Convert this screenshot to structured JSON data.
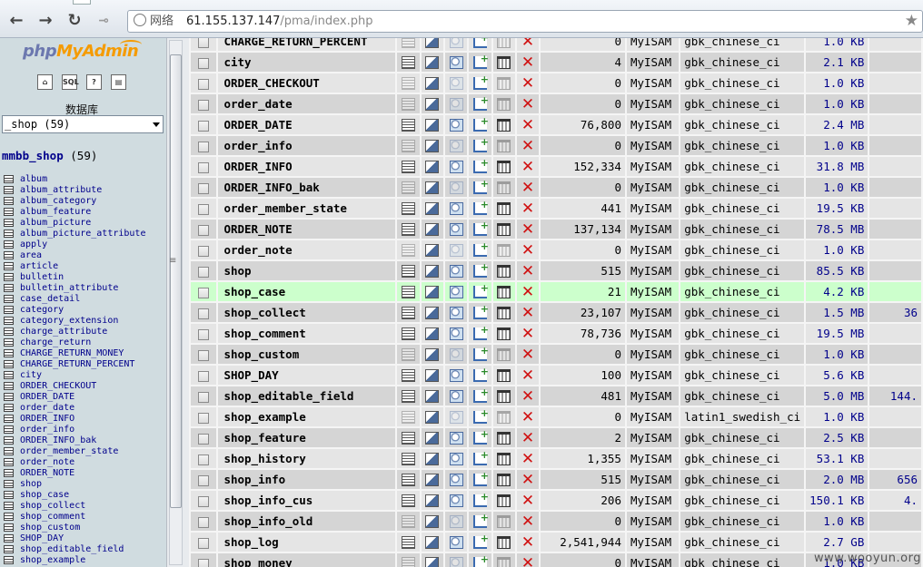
{
  "browser": {
    "site_label": "网络",
    "url_host": "61.155.137.147",
    "url_path": "/pma/index.php"
  },
  "sidebar": {
    "logo_php": "php",
    "logo_myadmin": "MyAdmin",
    "icons": [
      "home-icon",
      "sql-icon",
      "help-icon",
      "docs-icon"
    ],
    "icon_texts": [
      "⌂",
      "SQL",
      "?",
      "▤"
    ],
    "db_label": "数据库",
    "db_select": "_shop (59)",
    "db_name": "mmbb_shop",
    "db_count": "(59)",
    "tables": [
      "album",
      "album_attribute",
      "album_category",
      "album_feature",
      "album_picture",
      "album_picture_attribute",
      "apply",
      "area",
      "article",
      "bulletin",
      "bulletin_attribute",
      "case_detail",
      "category",
      "category_extension",
      "charge_attribute",
      "charge_return",
      "CHARGE_RETURN_MONEY",
      "CHARGE_RETURN_PERCENT",
      "city",
      "ORDER_CHECKOUT",
      "ORDER_DATE",
      "order_date",
      "ORDER_INFO",
      "order_info",
      "ORDER_INFO_bak",
      "order_member_state",
      "order_note",
      "ORDER_NOTE",
      "shop",
      "shop_case",
      "shop_collect",
      "shop_comment",
      "shop_custom",
      "SHOP_DAY",
      "shop_editable_field",
      "shop_example"
    ]
  },
  "main": {
    "rows": [
      {
        "name": "CHARGE_RETURN_PERCENT",
        "rows": "0",
        "type": "MyISAM",
        "collation": "gbk_chinese_ci",
        "size": "1.0 KB",
        "overhead": "",
        "empty": true,
        "marked": false
      },
      {
        "name": "city",
        "rows": "4",
        "type": "MyISAM",
        "collation": "gbk_chinese_ci",
        "size": "2.1 KB",
        "overhead": "",
        "empty": false,
        "marked": false
      },
      {
        "name": "ORDER_CHECKOUT",
        "rows": "0",
        "type": "MyISAM",
        "collation": "gbk_chinese_ci",
        "size": "1.0 KB",
        "overhead": "",
        "empty": true,
        "marked": false
      },
      {
        "name": "order_date",
        "rows": "0",
        "type": "MyISAM",
        "collation": "gbk_chinese_ci",
        "size": "1.0 KB",
        "overhead": "",
        "empty": true,
        "marked": false
      },
      {
        "name": "ORDER_DATE",
        "rows": "76,800",
        "type": "MyISAM",
        "collation": "gbk_chinese_ci",
        "size": "2.4 MB",
        "overhead": "",
        "empty": false,
        "marked": false
      },
      {
        "name": "order_info",
        "rows": "0",
        "type": "MyISAM",
        "collation": "gbk_chinese_ci",
        "size": "1.0 KB",
        "overhead": "",
        "empty": true,
        "marked": false
      },
      {
        "name": "ORDER_INFO",
        "rows": "152,334",
        "type": "MyISAM",
        "collation": "gbk_chinese_ci",
        "size": "31.8 MB",
        "overhead": "",
        "empty": false,
        "marked": false
      },
      {
        "name": "ORDER_INFO_bak",
        "rows": "0",
        "type": "MyISAM",
        "collation": "gbk_chinese_ci",
        "size": "1.0 KB",
        "overhead": "",
        "empty": true,
        "marked": false
      },
      {
        "name": "order_member_state",
        "rows": "441",
        "type": "MyISAM",
        "collation": "gbk_chinese_ci",
        "size": "19.5 KB",
        "overhead": "",
        "empty": false,
        "marked": false
      },
      {
        "name": "ORDER_NOTE",
        "rows": "137,134",
        "type": "MyISAM",
        "collation": "gbk_chinese_ci",
        "size": "78.5 MB",
        "overhead": "",
        "empty": false,
        "marked": false
      },
      {
        "name": "order_note",
        "rows": "0",
        "type": "MyISAM",
        "collation": "gbk_chinese_ci",
        "size": "1.0 KB",
        "overhead": "",
        "empty": true,
        "marked": false
      },
      {
        "name": "shop",
        "rows": "515",
        "type": "MyISAM",
        "collation": "gbk_chinese_ci",
        "size": "85.5 KB",
        "overhead": "",
        "empty": false,
        "marked": false
      },
      {
        "name": "shop_case",
        "rows": "21",
        "type": "MyISAM",
        "collation": "gbk_chinese_ci",
        "size": "4.2 KB",
        "overhead": "",
        "empty": false,
        "marked": true
      },
      {
        "name": "shop_collect",
        "rows": "23,107",
        "type": "MyISAM",
        "collation": "gbk_chinese_ci",
        "size": "1.5 MB",
        "overhead": "36",
        "empty": false,
        "marked": false
      },
      {
        "name": "shop_comment",
        "rows": "78,736",
        "type": "MyISAM",
        "collation": "gbk_chinese_ci",
        "size": "19.5 MB",
        "overhead": "",
        "empty": false,
        "marked": false
      },
      {
        "name": "shop_custom",
        "rows": "0",
        "type": "MyISAM",
        "collation": "gbk_chinese_ci",
        "size": "1.0 KB",
        "overhead": "",
        "empty": true,
        "marked": false
      },
      {
        "name": "SHOP_DAY",
        "rows": "100",
        "type": "MyISAM",
        "collation": "gbk_chinese_ci",
        "size": "5.6 KB",
        "overhead": "",
        "empty": false,
        "marked": false
      },
      {
        "name": "shop_editable_field",
        "rows": "481",
        "type": "MyISAM",
        "collation": "gbk_chinese_ci",
        "size": "5.0 MB",
        "overhead": "144.",
        "empty": false,
        "marked": false
      },
      {
        "name": "shop_example",
        "rows": "0",
        "type": "MyISAM",
        "collation": "latin1_swedish_ci",
        "size": "1.0 KB",
        "overhead": "",
        "empty": true,
        "marked": false
      },
      {
        "name": "shop_feature",
        "rows": "2",
        "type": "MyISAM",
        "collation": "gbk_chinese_ci",
        "size": "2.5 KB",
        "overhead": "",
        "empty": false,
        "marked": false
      },
      {
        "name": "shop_history",
        "rows": "1,355",
        "type": "MyISAM",
        "collation": "gbk_chinese_ci",
        "size": "53.1 KB",
        "overhead": "",
        "empty": false,
        "marked": false
      },
      {
        "name": "shop_info",
        "rows": "515",
        "type": "MyISAM",
        "collation": "gbk_chinese_ci",
        "size": "2.0 MB",
        "overhead": "656",
        "empty": false,
        "marked": false
      },
      {
        "name": "shop_info_cus",
        "rows": "206",
        "type": "MyISAM",
        "collation": "gbk_chinese_ci",
        "size": "150.1 KB",
        "overhead": "4.",
        "empty": false,
        "marked": false
      },
      {
        "name": "shop_info_old",
        "rows": "0",
        "type": "MyISAM",
        "collation": "gbk_chinese_ci",
        "size": "1.0 KB",
        "overhead": "",
        "empty": true,
        "marked": false
      },
      {
        "name": "shop_log",
        "rows": "2,541,944",
        "type": "MyISAM",
        "collation": "gbk_chinese_ci",
        "size": "2.7 GB",
        "overhead": "",
        "empty": false,
        "marked": false
      },
      {
        "name": "shop_money",
        "rows": "0",
        "type": "MyISAM",
        "collation": "gbk_chinese_ci",
        "size": "1.0 KB",
        "overhead": "",
        "empty": true,
        "marked": false
      }
    ]
  },
  "watermark": "www.wooyun.org",
  "colors": {
    "marked_row": "#ccffcc",
    "drop_icon": "#d01010",
    "link": "#00008b"
  }
}
